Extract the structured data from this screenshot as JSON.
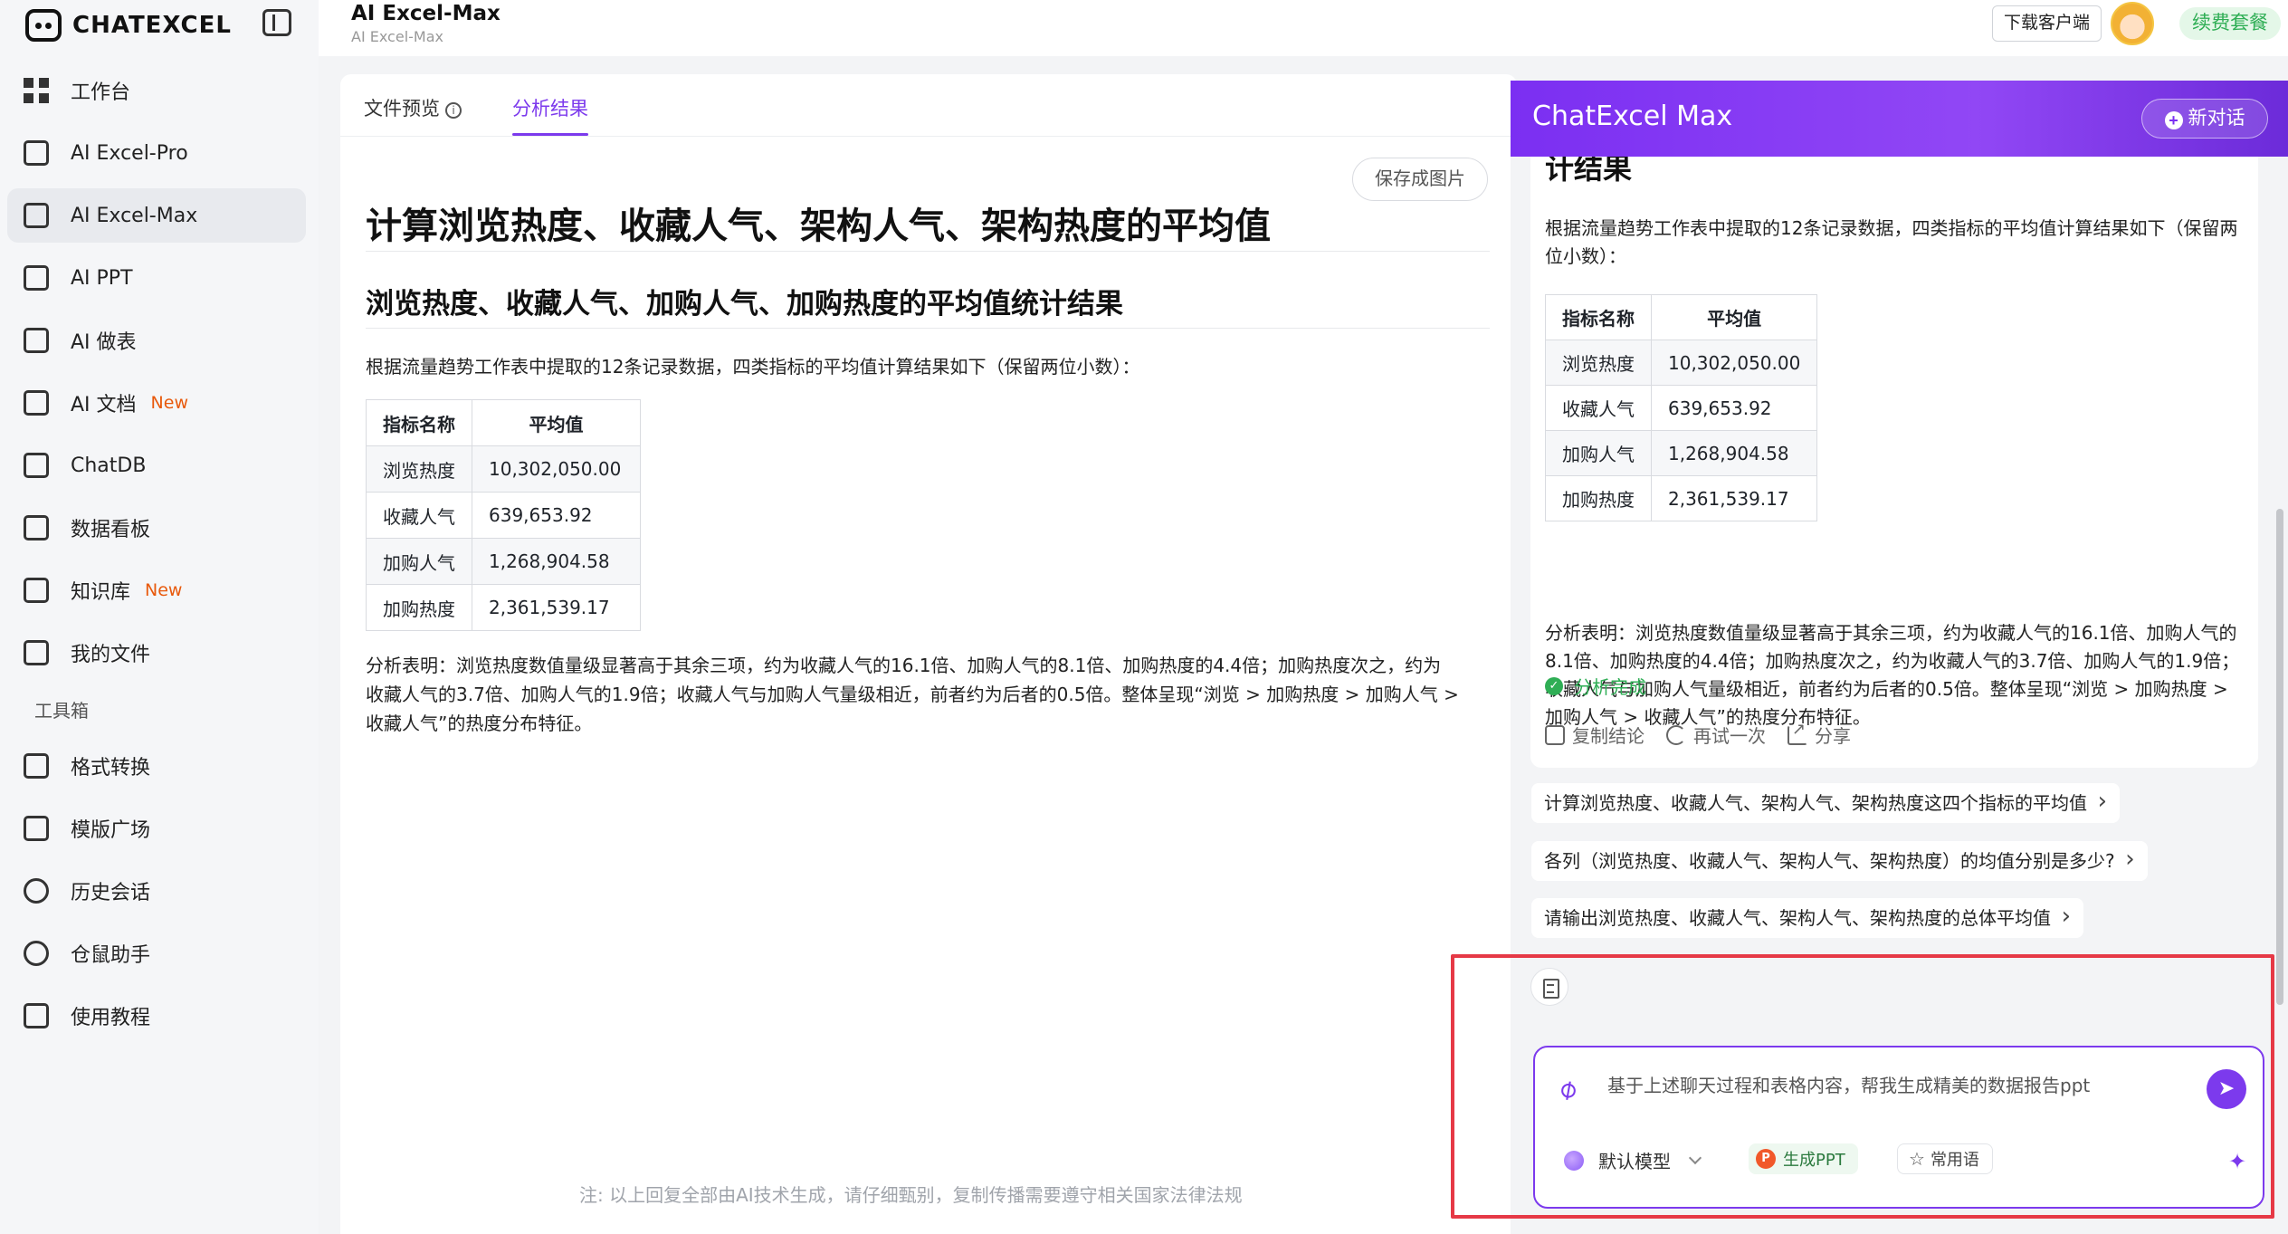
{
  "sidebar": {
    "logo_text": "CHATEXCEL",
    "items": [
      {
        "label": "工作台"
      },
      {
        "label": "AI Excel-Pro"
      },
      {
        "label": "AI Excel-Max"
      },
      {
        "label": "AI PPT"
      },
      {
        "label": "AI 做表"
      },
      {
        "label": "AI 文档",
        "badge": "New"
      },
      {
        "label": "ChatDB"
      },
      {
        "label": "数据看板"
      },
      {
        "label": "知识库",
        "badge": "New"
      },
      {
        "label": "我的文件"
      }
    ],
    "toolbox_label": "工具箱",
    "tools": [
      {
        "label": "格式转换"
      },
      {
        "label": "模版广场"
      },
      {
        "label": "历史会话"
      },
      {
        "label": "仓鼠助手"
      },
      {
        "label": "使用教程"
      }
    ],
    "active_item": "AI Excel-Max"
  },
  "header": {
    "title": "AI Excel-Max",
    "subtitle": "AI Excel-Max",
    "download_label": "下载客户端",
    "renew_label": "续费套餐"
  },
  "main": {
    "tabs": [
      {
        "label": "文件预览"
      },
      {
        "label": "分析结果"
      }
    ],
    "active_tab": "分析结果",
    "save_image_label": "保存成图片",
    "doc_title": "计算浏览热度、收藏人气、架构人气、架构热度的平均值",
    "doc_subtitle": "浏览热度、收藏人气、加购人气、加购热度的平均值统计结果",
    "intro": "根据流量趋势工作表中提取的12条记录数据，四类指标的平均值计算结果如下（保留两位小数）：",
    "table": {
      "headers": [
        "指标名称",
        "平均值"
      ],
      "rows": [
        [
          "浏览热度",
          "10,302,050.00"
        ],
        [
          "收藏人气",
          "639,653.92"
        ],
        [
          "加购人气",
          "1,268,904.58"
        ],
        [
          "加购热度",
          "2,361,539.17"
        ]
      ]
    },
    "analysis_line1": "分析表明：浏览热度数值量级显著高于其余三项，约为收藏人气的16.1倍、加购人气的8.1倍、加购热度的4.4倍；加购热度次之，约为",
    "analysis_line2": "收藏人气的3.7倍、加购人气的1.9倍；收藏人气与加购人气量级相近，前者约为后者的0.5倍。整体呈现“浏览 > 加购热度 > 加购人气 >",
    "analysis_line3": "收藏人气”的热度分布特征。",
    "disclaimer": "注: 以上回复全部由AI技术生成，请仔细甄别，复制传播需要遵守相关国家法律法规"
  },
  "chat": {
    "title": "ChatExcel Max",
    "new_chat_label": "新对话",
    "answer": {
      "heading": "计结果",
      "intro": "根据流量趋势工作表中提取的12条记录数据，四类指标的平均值计算结果如下（保留两位小数）：",
      "table": {
        "headers": [
          "指标名称",
          "平均值"
        ],
        "rows": [
          [
            "浏览热度",
            "10,302,050.00"
          ],
          [
            "收藏人气",
            "639,653.92"
          ],
          [
            "加购人气",
            "1,268,904.58"
          ],
          [
            "加购热度",
            "2,361,539.17"
          ]
        ]
      },
      "analysis": "分析表明：浏览热度数值量级显著高于其余三项，约为收藏人气的16.1倍、加购人气的8.1倍、加购热度的4.4倍；加购热度次之，约为收藏人气的3.7倍、加购人气的1.9倍；收藏人气与加购人气量级相近，前者约为后者的0.5倍。整体呈现“浏览 > 加购热度 > 加购人气 > 收藏人气”的热度分布特征。",
      "status": "分析完成",
      "actions": {
        "copy": "复制结论",
        "retry": "再试一次",
        "share": "分享"
      }
    },
    "suggestions": [
      "计算浏览热度、收藏人气、架构人气、架构热度这四个指标的平均值",
      "各列（浏览热度、收藏人气、架构人气、架构热度）的均值分别是多少?",
      "请输出浏览热度、收藏人气、架构人气、架构热度的总体平均值"
    ],
    "input": {
      "value": "",
      "placeholder": "基于上述聊天过程和表格内容，帮我生成精美的数据报告ppt",
      "model_label": "默认模型",
      "ppt_label": "生成PPT",
      "ppt_icon_letter": "P",
      "phrases_label": "常用语"
    }
  },
  "colors": {
    "accent": "#7c3aed",
    "success": "#2fae55",
    "highlight_outline": "#e63946"
  }
}
